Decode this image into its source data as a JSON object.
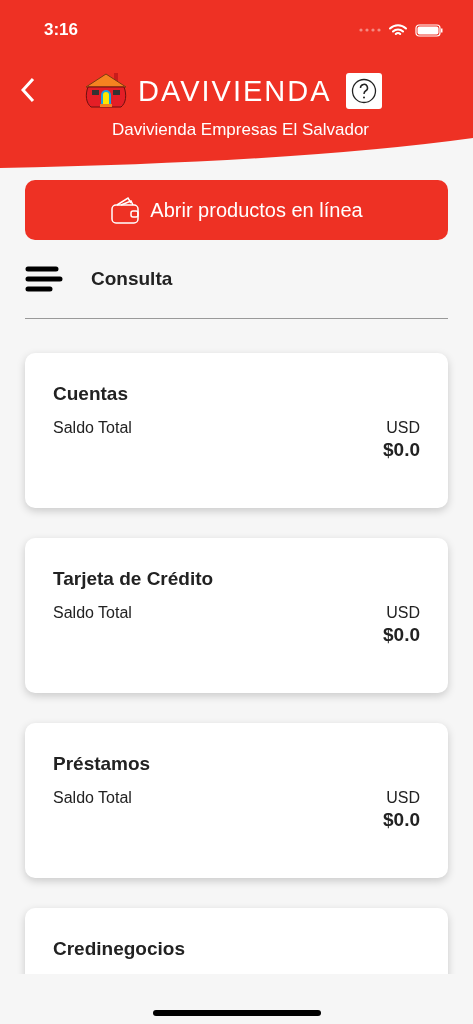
{
  "status_bar": {
    "time": "3:16"
  },
  "header": {
    "logo_text": "DAVIVIENDA",
    "subtitle": "Davivienda Empresas El Salvador"
  },
  "open_button": {
    "label": "Abrir productos en línea"
  },
  "section": {
    "title": "Consulta"
  },
  "products": [
    {
      "name": "Cuentas",
      "balance_label": "Saldo Total",
      "currency": "USD",
      "amount": "$0.0"
    },
    {
      "name": "Tarjeta de Crédito",
      "balance_label": "Saldo Total",
      "currency": "USD",
      "amount": "$0.0"
    },
    {
      "name": "Préstamos",
      "balance_label": "Saldo Total",
      "currency": "USD",
      "amount": "$0.0"
    },
    {
      "name": "Credinegocios"
    }
  ]
}
